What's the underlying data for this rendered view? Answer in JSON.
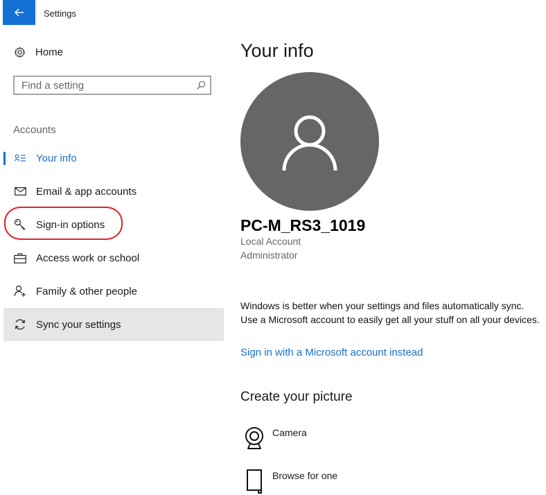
{
  "window": {
    "title": "Settings"
  },
  "sidebar": {
    "home_label": "Home",
    "search_placeholder": "Find a setting",
    "section_label": "Accounts",
    "items": [
      {
        "label": "Your info",
        "icon": "person-card-icon",
        "active": true
      },
      {
        "label": "Email & app accounts",
        "icon": "mail-icon"
      },
      {
        "label": "Sign-in options",
        "icon": "key-icon",
        "annotated": true
      },
      {
        "label": "Access work or school",
        "icon": "briefcase-icon"
      },
      {
        "label": "Family & other people",
        "icon": "person-add-icon"
      },
      {
        "label": "Sync your settings",
        "icon": "sync-icon",
        "hovered": true
      }
    ]
  },
  "main": {
    "title": "Your info",
    "account_name": "PC-M_RS3_1019",
    "account_type": "Local Account",
    "account_role": "Administrator",
    "sync_message": "Windows is better when your settings and files automatically sync. Use a Microsoft account to easily get all your stuff on all your devices.",
    "ms_link": "Sign in with a Microsoft account instead",
    "create_picture_heading": "Create your picture",
    "picture_options": [
      {
        "label": "Camera",
        "icon": "camera-icon"
      },
      {
        "label": "Browse for one",
        "icon": "browse-icon"
      }
    ]
  },
  "colors": {
    "accent": "#1570d3",
    "link": "#1a6fcc",
    "avatar_bg": "#666666",
    "annotation": "#e0232b",
    "hover_bg": "#e6e6e6"
  }
}
